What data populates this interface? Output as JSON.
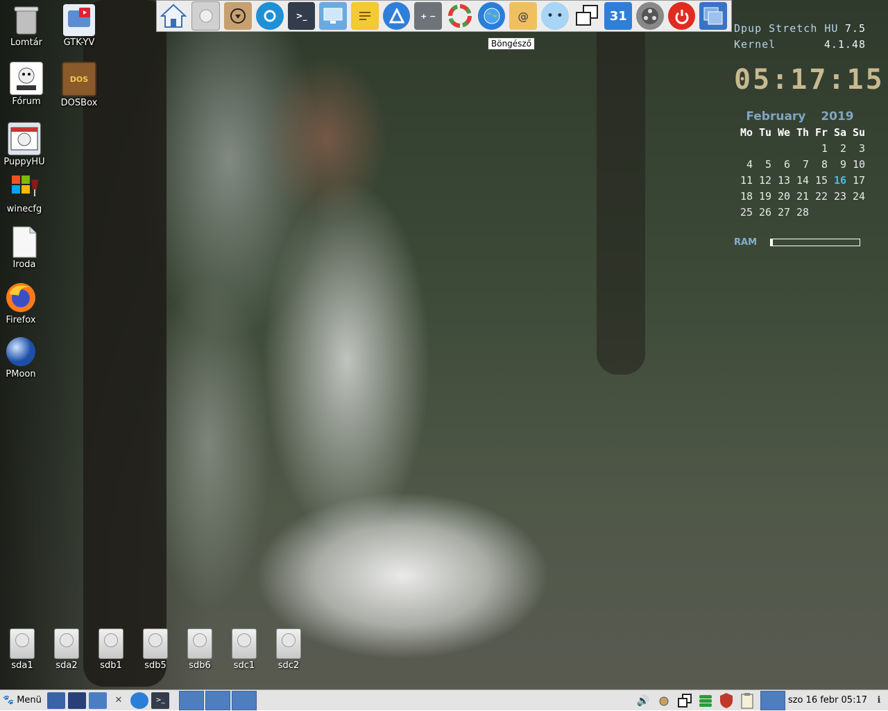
{
  "desktop_icons": [
    {
      "label": "Lomtár",
      "icon": "trash-icon"
    },
    {
      "label": "GTK-YV",
      "icon": "youtube-downloader-icon"
    },
    {
      "label": "Fórum",
      "icon": "puppy-linux-forum-icon"
    },
    {
      "label": "DOSBox",
      "icon": "dosbox-icon"
    },
    {
      "label": "PuppyHU",
      "icon": "puppyhu-icon"
    },
    {
      "label": "winecfg",
      "icon": "wine-icon"
    },
    {
      "label": "Iroda",
      "icon": "office-document-icon"
    },
    {
      "label": "Firefox",
      "icon": "firefox-icon"
    },
    {
      "label": "PMoon",
      "icon": "moon-icon"
    }
  ],
  "drives": [
    "sda1",
    "sda2",
    "sdb1",
    "sdb5",
    "sdb6",
    "sdc1",
    "sdc2"
  ],
  "top_launcher": {
    "icons": [
      "home-icon",
      "drive-icon",
      "install-icon",
      "settings-icon",
      "terminal-icon",
      "monitor-icon",
      "notes-icon",
      "appstore-icon",
      "calculator-icon",
      "color-wheel-icon",
      "browser-globe-icon",
      "email-icon",
      "chat-icon",
      "windows-icon",
      "calendar-icon",
      "media-reel-icon",
      "power-icon",
      "desktop-switch-icon"
    ],
    "calendar_day": "31",
    "tooltip": "Böngésző"
  },
  "conky": {
    "distro_label": "Dpup Stretch HU",
    "distro_version": "7.5",
    "kernel_label": "Kernel",
    "kernel_version": "4.1.48",
    "time": "05:17:15",
    "calendar_month": "February",
    "calendar_year": "2019",
    "weekday_headers": [
      "Mo",
      "Tu",
      "We",
      "Th",
      "Fr",
      "Sa",
      "Su"
    ],
    "days": [
      "",
      "",
      "",
      "",
      "1",
      "2",
      "3",
      "4",
      "5",
      "6",
      "7",
      "8",
      "9",
      "10",
      "11",
      "12",
      "13",
      "14",
      "15",
      "16",
      "17",
      "18",
      "19",
      "20",
      "21",
      "22",
      "23",
      "24",
      "25",
      "26",
      "27",
      "28"
    ],
    "today": "16",
    "ram_label": "RAM",
    "ram_usage": 0.02
  },
  "taskbar": {
    "menu_label": "Menü",
    "clock": "szo 16 febr 05:17",
    "tray_icons": [
      "volume-icon",
      "network-icon",
      "window-switch-icon",
      "storage-icon",
      "firewall-icon",
      "clipboard-icon"
    ]
  },
  "colors": {
    "taskbar_slot": "#4f7ebf",
    "today": "#3fc0e8",
    "clock": "#c9b98f"
  }
}
